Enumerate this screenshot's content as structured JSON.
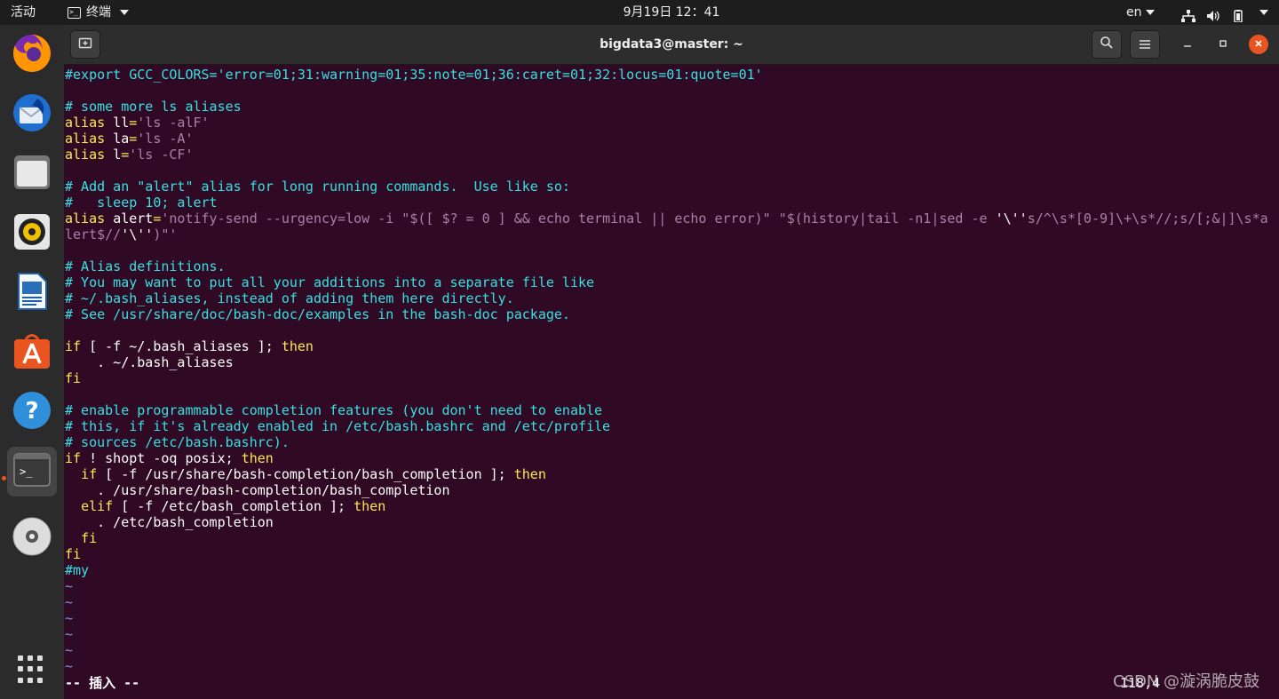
{
  "topbar": {
    "activities": "活动",
    "app_name": "终端",
    "clock": "9月19日  12：41",
    "lang": "en"
  },
  "dock": {
    "items": [
      "firefox-icon",
      "thunderbird-icon",
      "files-icon",
      "rhythmbox-icon",
      "writer-icon",
      "software-icon",
      "help-icon",
      "terminal-icon",
      "disc-icon",
      "apps-grid-icon"
    ]
  },
  "window": {
    "title": "bigdata3@master: ~"
  },
  "terminal": {
    "lines": [
      [
        [
          "c",
          "#export GCC_COLORS='error=01;31:warning=01;35:note=01;36:caret=01;32:locus=01:quote=01'"
        ]
      ],
      [],
      [
        [
          "c",
          "# some more ls aliases"
        ]
      ],
      [
        [
          "y",
          "alias "
        ],
        [
          "w",
          "ll"
        ],
        [
          "y",
          "="
        ],
        [
          "p",
          "'ls -alF'"
        ]
      ],
      [
        [
          "y",
          "alias "
        ],
        [
          "w",
          "la"
        ],
        [
          "y",
          "="
        ],
        [
          "p",
          "'ls -A'"
        ]
      ],
      [
        [
          "y",
          "alias "
        ],
        [
          "w",
          "l"
        ],
        [
          "y",
          "="
        ],
        [
          "p",
          "'ls -CF'"
        ]
      ],
      [],
      [
        [
          "c",
          "# Add an \"alert\" alias for long running commands.  Use like so:"
        ]
      ],
      [
        [
          "c",
          "#   sleep 10; alert"
        ]
      ],
      [
        [
          "y",
          "alias "
        ],
        [
          "w",
          "alert"
        ],
        [
          "y",
          "="
        ],
        [
          "p",
          "'notify-send --urgency=low -i \"$([ $? = 0 ] && echo terminal || echo error)\" \"$(history|tail -n1|sed -e "
        ],
        [
          "w",
          "'\\''"
        ],
        [
          "p",
          "s/^\\s*[0-9]\\+\\s*//;s/[;&|]\\s*a"
        ]
      ],
      [
        [
          "p",
          "lert$//"
        ],
        [
          "w",
          "'\\''"
        ],
        [
          "p",
          ")\"'"
        ]
      ],
      [],
      [
        [
          "c",
          "# Alias definitions."
        ]
      ],
      [
        [
          "c",
          "# You may want to put all your additions into a separate file like"
        ]
      ],
      [
        [
          "c",
          "# ~/.bash_aliases, instead of adding them here directly."
        ]
      ],
      [
        [
          "c",
          "# See /usr/share/doc/bash-doc/examples in the bash-doc package."
        ]
      ],
      [],
      [
        [
          "y",
          "if"
        ],
        [
          "w",
          " [ -f ~/.bash_aliases ]; "
        ],
        [
          "y",
          "then"
        ]
      ],
      [
        [
          "w",
          "    . ~/.bash_aliases"
        ]
      ],
      [
        [
          "y",
          "fi"
        ]
      ],
      [],
      [
        [
          "c",
          "# enable programmable completion features (you don't need to enable"
        ]
      ],
      [
        [
          "c",
          "# this, if it's already enabled in /etc/bash.bashrc and /etc/profile"
        ]
      ],
      [
        [
          "c",
          "# sources /etc/bash.bashrc)."
        ]
      ],
      [
        [
          "y",
          "if"
        ],
        [
          "w",
          " ! shopt -oq posix; "
        ],
        [
          "y",
          "then"
        ]
      ],
      [
        [
          "w",
          "  "
        ],
        [
          "y",
          "if"
        ],
        [
          "w",
          " [ -f /usr/share/bash-completion/bash_completion ]; "
        ],
        [
          "y",
          "then"
        ]
      ],
      [
        [
          "w",
          "    . /usr/share/bash-completion/bash_completion"
        ]
      ],
      [
        [
          "w",
          "  "
        ],
        [
          "y",
          "elif"
        ],
        [
          "w",
          " [ -f /etc/bash_completion ]; "
        ],
        [
          "y",
          "then"
        ]
      ],
      [
        [
          "w",
          "    . /etc/bash_completion"
        ]
      ],
      [
        [
          "w",
          "  "
        ],
        [
          "y",
          "fi"
        ]
      ],
      [
        [
          "y",
          "fi"
        ]
      ],
      [
        [
          "c",
          "#my"
        ]
      ],
      [
        [
          "b",
          "~"
        ]
      ],
      [
        [
          "b",
          "~"
        ]
      ],
      [
        [
          "b",
          "~"
        ]
      ],
      [
        [
          "b",
          "~"
        ]
      ],
      [
        [
          "b",
          "~"
        ]
      ],
      [
        [
          "b",
          "~"
        ]
      ]
    ],
    "status": "-- 插入 --",
    "ruler": "118,4",
    "watermark": "CSDN @漩涡脆皮鼓"
  }
}
